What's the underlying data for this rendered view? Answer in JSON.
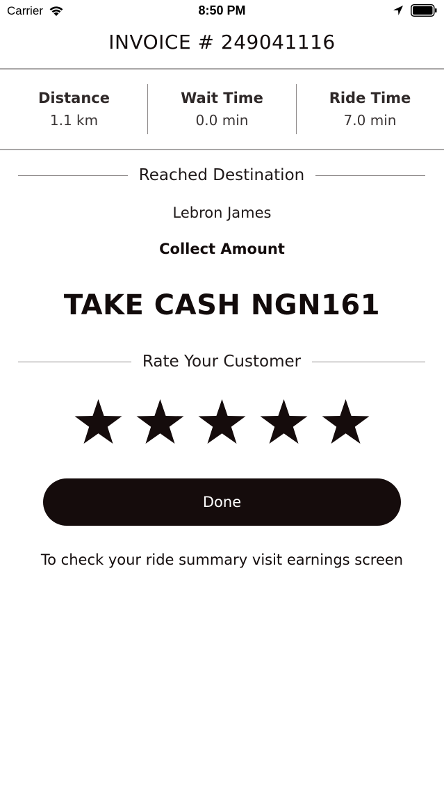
{
  "status_bar": {
    "carrier": "Carrier",
    "time": "8:50 PM"
  },
  "header": {
    "title": "INVOICE # 249041116"
  },
  "stats": [
    {
      "label": "Distance",
      "value": "1.1 km"
    },
    {
      "label": "Wait Time",
      "value": "0.0 min"
    },
    {
      "label": "Ride Time",
      "value": "7.0 min"
    }
  ],
  "trip": {
    "status_heading": "Reached Destination",
    "customer_name": "Lebron James",
    "collect_label": "Collect Amount",
    "amount_text": "TAKE CASH NGN161"
  },
  "rating": {
    "heading": "Rate Your Customer",
    "value": 5,
    "max": 5
  },
  "actions": {
    "done_label": "Done"
  },
  "footer": {
    "note": "To check your ride summary visit earnings screen"
  },
  "colors": {
    "primary": "#150c0c",
    "divider": "#a9a7a7",
    "background": "#ffffff"
  }
}
